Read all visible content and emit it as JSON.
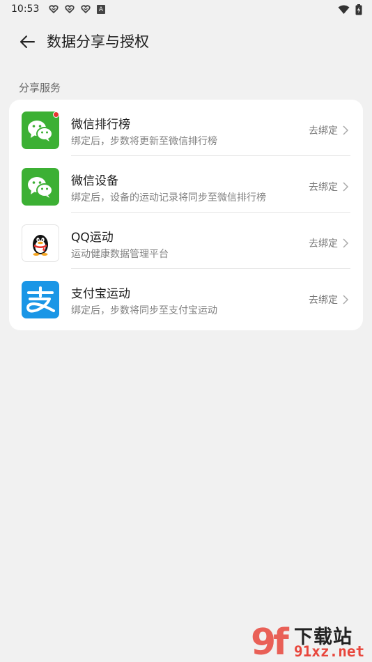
{
  "status_bar": {
    "time": "10:53",
    "notif_a": "A"
  },
  "header": {
    "title": "数据分享与授权"
  },
  "section": {
    "label": "分享服务"
  },
  "services": [
    {
      "title": "微信排行榜",
      "subtitle": "绑定后，步数将更新至微信排行榜",
      "action": "去绑定",
      "icon": "wechat-icon",
      "badge": true
    },
    {
      "title": "微信设备",
      "subtitle": "绑定后，设备的运动记录将同步至微信排行榜",
      "action": "去绑定",
      "icon": "wechat-icon",
      "badge": false
    },
    {
      "title": "QQ运动",
      "subtitle": "运动健康数据管理平台",
      "action": "去绑定",
      "icon": "qq-penguin-icon",
      "badge": false
    },
    {
      "title": "支付宝运动",
      "subtitle": "绑定后，步数将同步至支付宝运动",
      "action": "去绑定",
      "icon": "alipay-icon",
      "badge": false
    }
  ],
  "watermark": {
    "logo": "9f",
    "top": "下载站",
    "bottom": "91xz.net"
  },
  "colors": {
    "background": "#f1f1f1",
    "card": "#ffffff",
    "wechat_green": "#3cb034",
    "alipay_blue": "#1a96e6",
    "badge_red": "#e8332e"
  }
}
